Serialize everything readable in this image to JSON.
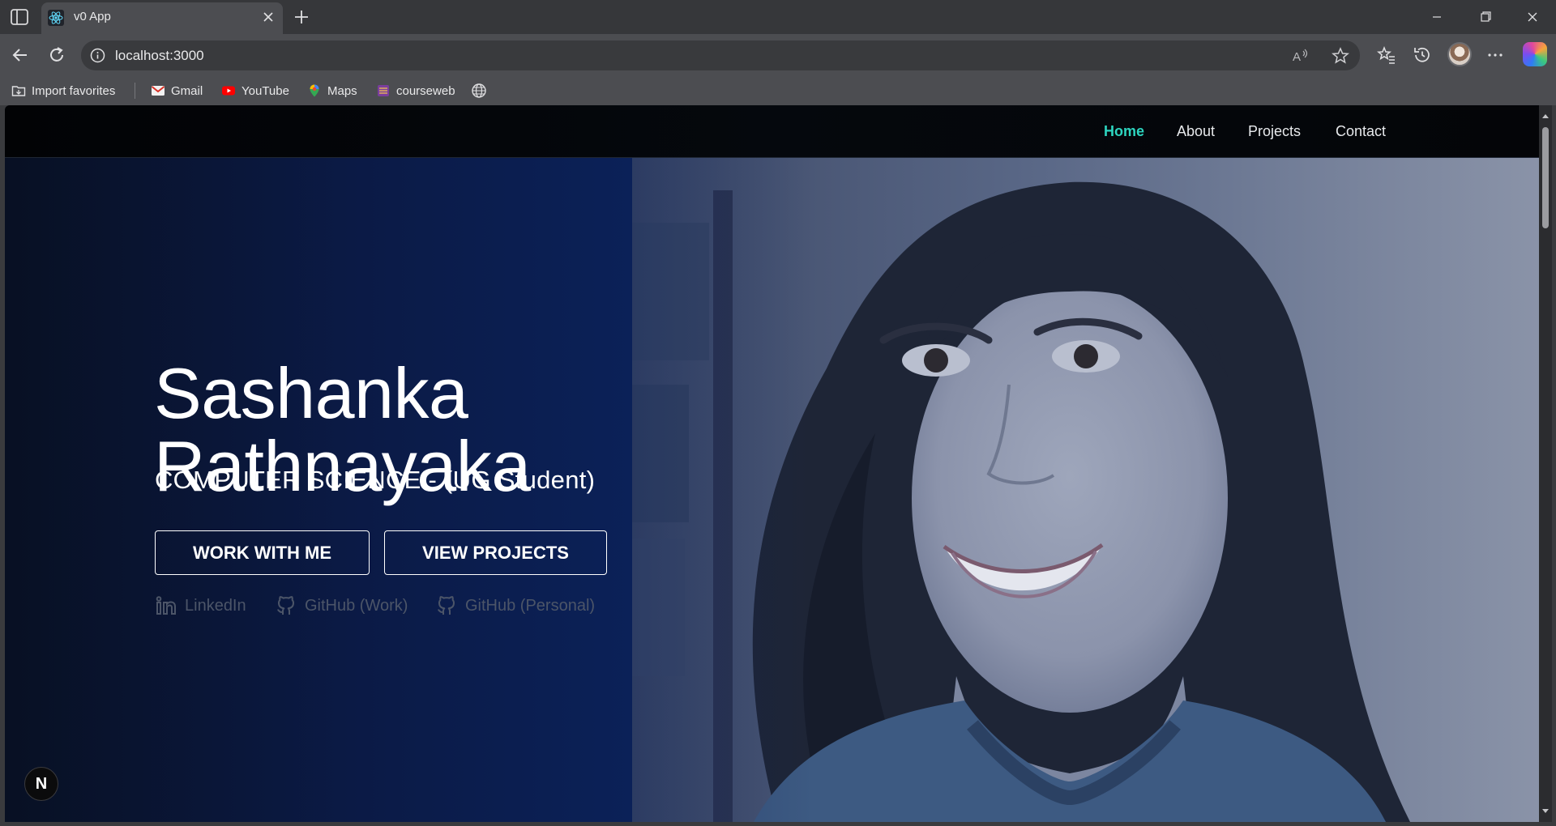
{
  "browser": {
    "tab_title": "v0 App",
    "url": "localhost:3000",
    "bookmarks": [
      {
        "label": "Import favorites"
      },
      {
        "label": "Gmail"
      },
      {
        "label": "YouTube"
      },
      {
        "label": "Maps"
      },
      {
        "label": "courseweb"
      }
    ]
  },
  "nav": {
    "links": [
      "Home",
      "About",
      "Projects",
      "Contact"
    ],
    "active": "Home",
    "active_color": "#2dd4bf"
  },
  "hero": {
    "name_line1": "Sashanka",
    "name_line2": "Rathnayaka",
    "role": "COMPUTER SCIENCE - (UG Student)",
    "buttons": {
      "work": "WORK WITH ME",
      "projects": "VIEW PROJECTS"
    },
    "socials": [
      "LinkedIn",
      "GitHub (Work)",
      "GitHub (Personal)"
    ]
  },
  "dev_badge": "N"
}
